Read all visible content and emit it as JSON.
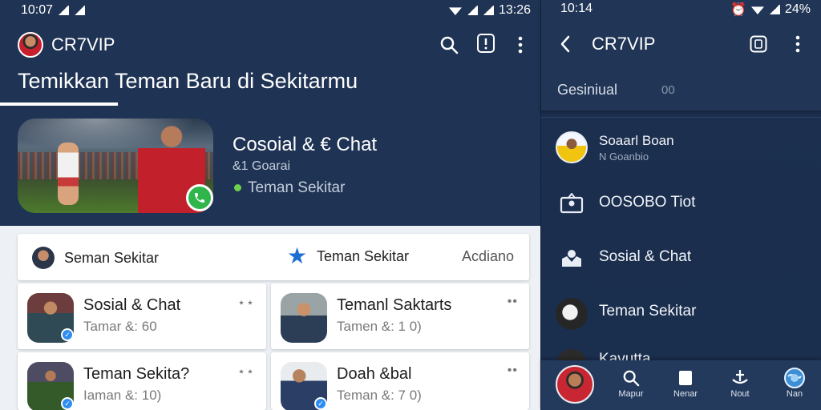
{
  "left": {
    "status": {
      "time": "10:07",
      "right": "13:26"
    },
    "appbar": {
      "title": "CR7VIP"
    },
    "headline": "Temikkan Teman Baru di Sekitarmu",
    "hero": {
      "title": "Cosoial & € Chat",
      "subtitle": "&1 Goarai",
      "meta": "Teman Sekitar"
    },
    "filter": {
      "left_label": "Seman Sekitar",
      "mid_label": "Teman Sekitar",
      "right_label": "Acdiano"
    },
    "cards": [
      {
        "title": "Sosial & Chat",
        "subtitle": "Tamar &: 60",
        "more": "⋆⋆"
      },
      {
        "title": "Temanl Saktarts",
        "subtitle": "Tamen &: 1 0)",
        "more": "••"
      },
      {
        "title": "Teman Sekita?",
        "subtitle": "Iaman &: 10)",
        "more": "⋆⋆"
      },
      {
        "title": "Doah &bal",
        "subtitle": "Teman &: 7 0)",
        "more": "••"
      }
    ]
  },
  "right": {
    "status": {
      "time": "10:14",
      "battery": "24%"
    },
    "appbar": {
      "title": "CR7VIP"
    },
    "section": {
      "label": "Gesiniual",
      "count": "00"
    },
    "items": [
      {
        "label": "Soaarl Boan",
        "sub": "N Goanbio"
      },
      {
        "label": "OOSOBO Tiot"
      },
      {
        "label": "Sosial & Chat"
      },
      {
        "label": "Teman Sekitar"
      },
      {
        "label": "Kavutta"
      }
    ],
    "bottom_nav": [
      {
        "label": "Mapur"
      },
      {
        "label": "Nenar"
      },
      {
        "label": "Nout"
      },
      {
        "label": "Nan"
      }
    ]
  },
  "colors": {
    "navy": "#1f3354",
    "accent_green": "#2fb54a",
    "star_blue": "#1f6fd1"
  }
}
